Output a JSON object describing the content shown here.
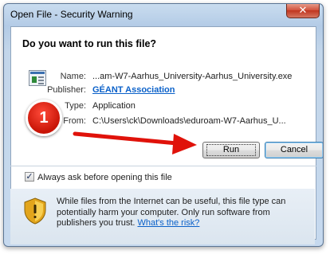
{
  "window": {
    "title": "Open File - Security Warning",
    "close_glyph": "✕"
  },
  "question": "Do you want to run this file?",
  "file_info": {
    "icon": "application-file-icon",
    "name_label": "Name:",
    "name_value": "...am-W7-Aarhus_University-Aarhus_University.exe",
    "publisher_label": "Publisher:",
    "publisher_value": "GÉANT Association",
    "type_label": "Type:",
    "type_value": "Application",
    "from_label": "From:",
    "from_value": "C:\\Users\\ck\\Downloads\\eduroam-W7-Aarhus_U..."
  },
  "annotation": {
    "step_number": "1",
    "badge_color": "#d8180b",
    "arrow_color": "#e0120a"
  },
  "buttons": {
    "run_label": "Run",
    "cancel_label": "Cancel"
  },
  "checkbox": {
    "label": "Always ask before opening this file",
    "checked": true,
    "check_glyph": "✓"
  },
  "warning": {
    "icon": "security-shield-icon",
    "text": "While files from the Internet can be useful, this file type can potentially harm your computer. Only run software from publishers you trust.",
    "link_text": "What's the risk?"
  }
}
